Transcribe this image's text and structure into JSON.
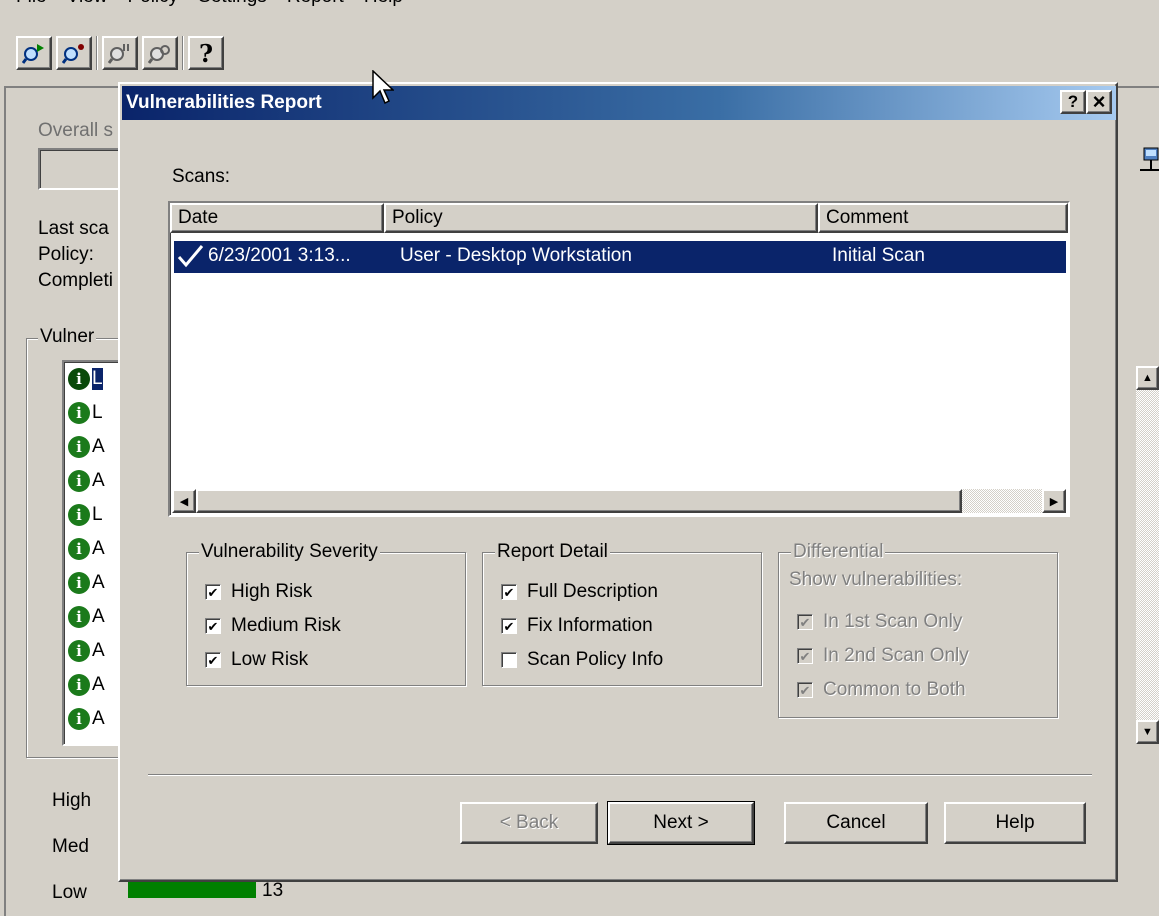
{
  "menu": [
    "File",
    "View",
    "Policy",
    "Settings",
    "Report",
    "Help"
  ],
  "toolbar": {
    "buttons": [
      {
        "icon": "scan-start-icon"
      },
      {
        "icon": "scan-config-icon"
      },
      {
        "icon": "scan-pause-icon"
      },
      {
        "icon": "scan-compare-icon"
      },
      {
        "icon": "help-icon",
        "glyph": "?"
      }
    ]
  },
  "background": {
    "overall_label": "Overall s",
    "last_scan_label": "Last sca",
    "policy_label": "Policy:",
    "completion_label": "Completi",
    "vuln_group_label": "Vulner",
    "vuln_items": [
      "L",
      "L",
      "A",
      "A",
      "L",
      "A",
      "A",
      "A",
      "A",
      "A",
      "A"
    ],
    "severity_rows": [
      {
        "label": "High"
      },
      {
        "label": "Med"
      },
      {
        "label": "Low",
        "value": "13",
        "fill": 1.0
      }
    ],
    "bar_color": "#008000"
  },
  "dialog": {
    "title": "Vulnerabilities Report",
    "help_btn": "?",
    "close_btn": "×",
    "scans_label": "Scans:",
    "columns": [
      "Date",
      "Policy",
      "Comment"
    ],
    "rows": [
      {
        "date": "6/23/2001 3:13...",
        "policy": "User - Desktop Workstation",
        "comment": "Initial Scan",
        "selected": true
      }
    ],
    "severity_group": {
      "title": "Vulnerability Severity",
      "items": [
        {
          "label": "High Risk",
          "checked": true
        },
        {
          "label": "Medium Risk",
          "checked": true
        },
        {
          "label": "Low Risk",
          "checked": true
        }
      ]
    },
    "detail_group": {
      "title": "Report Detail",
      "items": [
        {
          "label": "Full Description",
          "checked": true
        },
        {
          "label": "Fix Information",
          "checked": true
        },
        {
          "label": "Scan Policy Info",
          "checked": false
        }
      ]
    },
    "diff_group": {
      "title": "Differential",
      "subtitle": "Show vulnerabilities:",
      "items": [
        {
          "label": "In 1st Scan Only",
          "checked": true
        },
        {
          "label": "In 2nd Scan Only",
          "checked": true
        },
        {
          "label": "Common to Both",
          "checked": true
        }
      ]
    },
    "buttons": {
      "back": "< Back",
      "next": "Next >",
      "cancel": "Cancel",
      "help": "Help"
    }
  },
  "colors": {
    "face": "#d4d0c8",
    "selection": "#0a246a",
    "title_start": "#0a246a",
    "title_end": "#a6caf0",
    "info_icon": "#1b7a1b"
  }
}
